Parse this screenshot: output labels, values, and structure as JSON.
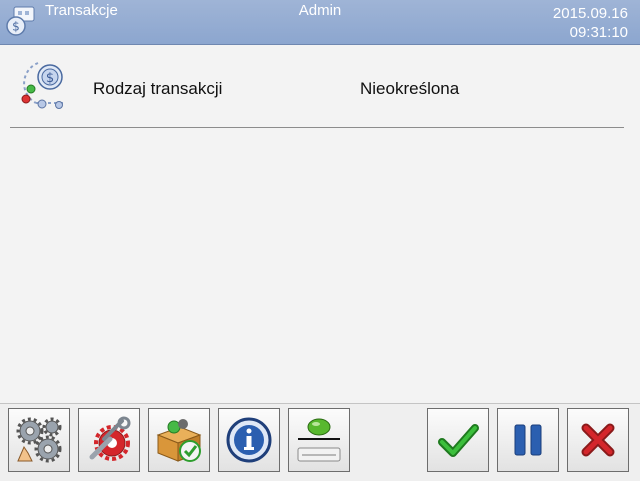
{
  "header": {
    "title": "Transakcje",
    "user": "Admin",
    "date": "2015.09.16",
    "time": "09:31:10",
    "app_icon": "dollar-transactions-icon"
  },
  "rows": [
    {
      "label": "Rodzaj transakcji",
      "value": "Nieokreślona",
      "icon": "transaction-type-icon"
    }
  ],
  "toolbar": {
    "left_buttons": [
      {
        "icon": "settings-gears-icon"
      },
      {
        "icon": "tools-wrench-icon"
      },
      {
        "icon": "database-products-icon"
      },
      {
        "icon": "info-icon"
      },
      {
        "icon": "scale-tare-icon"
      }
    ],
    "right_buttons": [
      {
        "icon": "checkmark-icon"
      },
      {
        "icon": "pause-icon"
      },
      {
        "icon": "close-x-icon"
      }
    ]
  },
  "colors": {
    "header_bg": "#9fb4d6",
    "accent_green": "#2e9e2e",
    "accent_blue": "#2b5fb0",
    "accent_red": "#d4262b"
  }
}
